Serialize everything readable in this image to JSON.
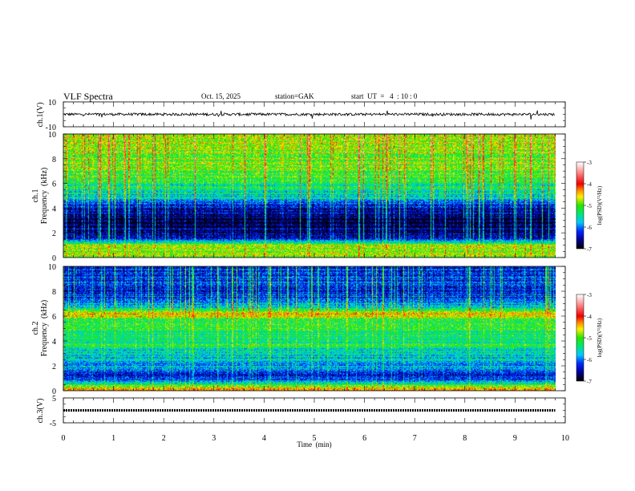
{
  "header": {
    "title": "VLF  Spectra",
    "date": "Oct. 15, 2025",
    "station": "station=GAK",
    "start_ut": "start  UT  =   4  : 10 : 0"
  },
  "chart_data": [
    {
      "type": "line",
      "name": "ch1-waveform",
      "ylabel": "ch.1(V)",
      "ylim": [
        -10,
        10
      ],
      "ytick_labels": [
        "10",
        "-10"
      ],
      "xlim": [
        0,
        10
      ],
      "data_end_min": 9.8,
      "mean_value": 0,
      "noise_amplitude": 1.5,
      "color": "#000000"
    },
    {
      "type": "heatmap",
      "name": "ch1-spectrogram",
      "ylabel": "ch.1\nFrequency (kHz)",
      "ylabel_top": "ch.1",
      "ylabel_bottom": "Frequency  (kHz)",
      "ylim": [
        0,
        10
      ],
      "ytick_labels": [
        "0",
        "2",
        "4",
        "6",
        "8",
        "10"
      ],
      "xlim": [
        0,
        10
      ],
      "data_end_min": 9.8,
      "freq_profile_khz": [
        0,
        0.3,
        0.6,
        1.0,
        1.5,
        2.0,
        3.0,
        4.0,
        4.5,
        5.0,
        5.8,
        6.5,
        8.0,
        10.0
      ],
      "freq_profile_logpsd": [
        -5.2,
        -4.6,
        -5.0,
        -4.8,
        -6.3,
        -6.6,
        -6.8,
        -6.5,
        -6.0,
        -5.6,
        -5.4,
        -5.1,
        -4.9,
        -4.7
      ]
    },
    {
      "type": "heatmap",
      "name": "ch2-spectrogram",
      "ylabel_top": "ch.2",
      "ylabel_bottom": "Frequency  (kHz)",
      "ylim": [
        0,
        10
      ],
      "ytick_labels": [
        "0",
        "2",
        "4",
        "6",
        "8",
        "10"
      ],
      "xlim": [
        0,
        10
      ],
      "data_end_min": 9.8,
      "freq_profile_khz": [
        0,
        0.3,
        0.6,
        1.0,
        1.5,
        2.0,
        3.0,
        4.0,
        5.0,
        5.8,
        6.2,
        6.6,
        7.5,
        10.0
      ],
      "freq_profile_logpsd": [
        -4.5,
        -4.8,
        -5.4,
        -6.4,
        -6.2,
        -5.9,
        -5.6,
        -5.3,
        -5.3,
        -5.2,
        -4.3,
        -5.4,
        -6.2,
        -6.3
      ]
    },
    {
      "type": "line",
      "name": "ch3-waveform",
      "ylabel": "ch.3(V)",
      "ylim": [
        -5,
        5
      ],
      "ytick_labels": [
        "5",
        "-5"
      ],
      "xlim": [
        0,
        10
      ],
      "data_end_min": 9.8,
      "mean_value": 0,
      "color": "#000000"
    }
  ],
  "xaxis": {
    "label": "Time  (min)",
    "tick_labels": [
      "0",
      "1",
      "2",
      "3",
      "4",
      "5",
      "6",
      "7",
      "8",
      "9",
      "10"
    ]
  },
  "colorbar": {
    "label": "log(PSD)(V²/Hz)",
    "range": [
      -7,
      -3
    ],
    "tick_labels": [
      "-3",
      "-4",
      "-5",
      "-6",
      "-7"
    ]
  }
}
